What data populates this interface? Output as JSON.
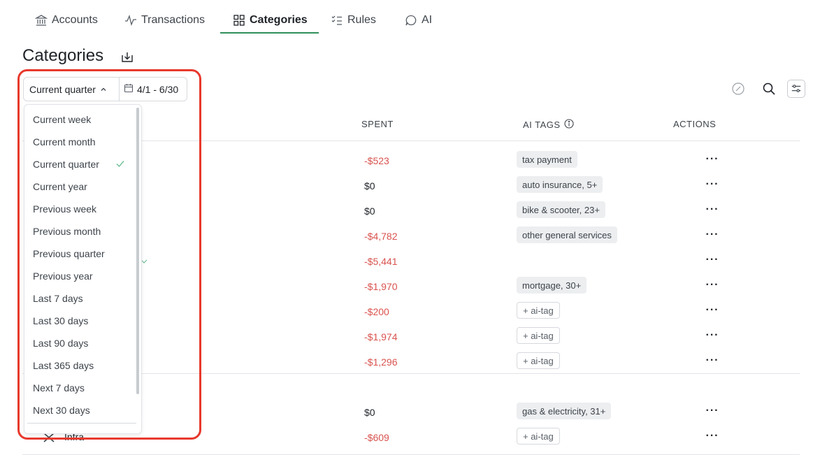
{
  "nav": {
    "tabs": [
      {
        "label": "Accounts",
        "icon": "bank-icon"
      },
      {
        "label": "Transactions",
        "icon": "activity-icon"
      },
      {
        "label": "Categories",
        "icon": "grid-icon",
        "active": true
      },
      {
        "label": "Rules",
        "icon": "checklist-icon"
      },
      {
        "label": "AI",
        "icon": "chat-bubble-icon"
      }
    ]
  },
  "header": {
    "title": "Categories"
  },
  "period": {
    "selected": "Current quarter",
    "range": "4/1 - 6/30",
    "options": [
      "Current week",
      "Current month",
      "Current quarter",
      "Current year",
      "Previous week",
      "Previous month",
      "Previous quarter",
      "Previous year",
      "Last 7 days",
      "Last 30 days",
      "Last 90 days",
      "Last 365 days",
      "Next 7 days",
      "Next 30 days"
    ],
    "checked_option": "Current quarter"
  },
  "table": {
    "columns": {
      "spent": "SPENT",
      "ai_tags": "AI TAGS",
      "actions": "ACTIONS"
    },
    "rows": [
      {
        "spent": "-$523",
        "tag": "tax payment",
        "tag_type": "tag"
      },
      {
        "spent": "$0",
        "tag": "auto insurance, 5+",
        "tag_type": "tag"
      },
      {
        "spent": "$0",
        "tag": "bike & scooter, 23+",
        "tag_type": "tag"
      },
      {
        "spent": "-$4,782",
        "tag": "other general services",
        "tag_type": "tag"
      },
      {
        "spent": "-$5,441",
        "tag": "",
        "tag_type": "none"
      },
      {
        "spent": "-$1,970",
        "tag": "mortgage, 30+",
        "tag_type": "tag"
      },
      {
        "spent": "-$200",
        "tag": "+ ai-tag",
        "tag_type": "add"
      },
      {
        "spent": "-$1,974",
        "tag": "+ ai-tag",
        "tag_type": "add"
      },
      {
        "spent": "-$1,296",
        "tag": "+ ai-tag",
        "tag_type": "add"
      },
      {
        "spent": "$0",
        "tag": "gas & electricity, 31+",
        "tag_type": "tag"
      },
      {
        "spent": "-$609",
        "tag": "+ ai-tag",
        "tag_type": "add"
      }
    ],
    "partial_row_name": "Infra",
    "actions_glyph": "···"
  },
  "colors": {
    "accent": "#2f8f5b",
    "negative": "#d9534f",
    "highlight": "#e8392d"
  }
}
